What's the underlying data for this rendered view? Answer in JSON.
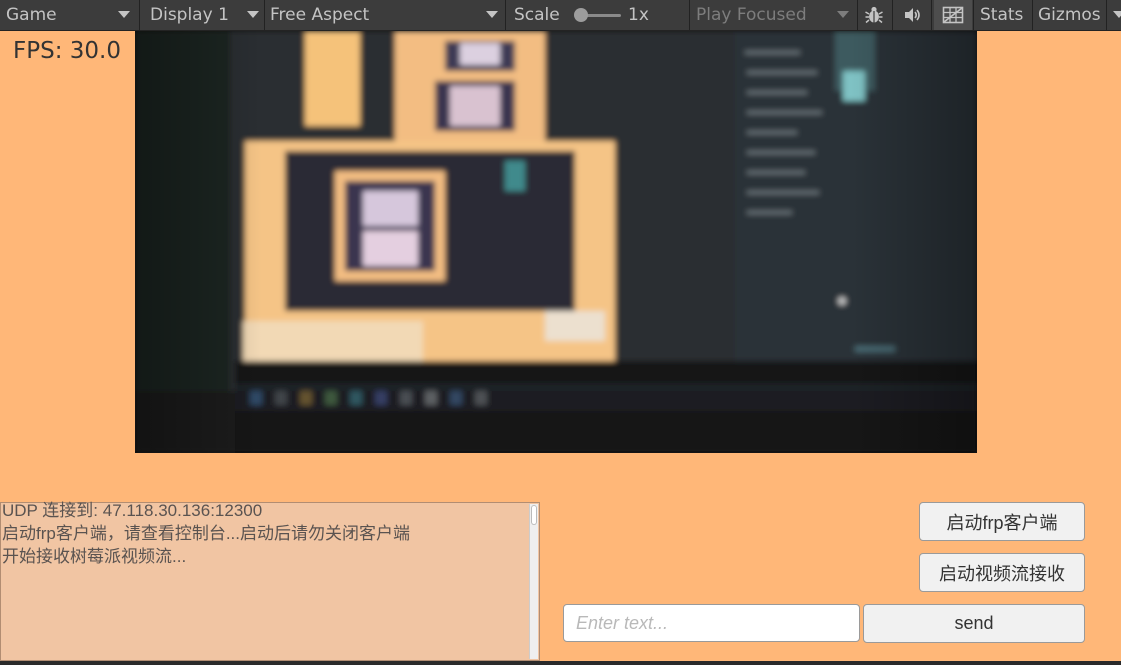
{
  "toolbar": {
    "view_label": "Game",
    "display_label": "Display 1",
    "aspect_label": "Free Aspect",
    "scale_label": "Scale",
    "scale_value": "1x",
    "play_mode_label": "Play Focused",
    "stats_label": "Stats",
    "gizmos_label": "Gizmos"
  },
  "fps": "FPS: 30.0",
  "log": {
    "lines": [
      "UDP 连接到: 47.118.30.136:12300",
      "启动frp客户端，请查看控制台...启动后请勿关闭客户端",
      "开始接收树莓派视频流..."
    ]
  },
  "controls": {
    "start_frp_button": "启动frp客户端",
    "start_video_button": "启动视频流接收",
    "message_input_placeholder": "Enter text...",
    "send_button": "send"
  },
  "icons": {
    "dropdown": "chevron-down-icon",
    "bug": "bug-icon",
    "audio": "speaker-icon",
    "gizmos_toggle": "grid-icon"
  },
  "colors": {
    "toolbar_bg": "#3c3c3c",
    "game_bg": "#ffb778",
    "log_bg": "#f1c5a3",
    "button_bg": "#f1f1f1"
  }
}
